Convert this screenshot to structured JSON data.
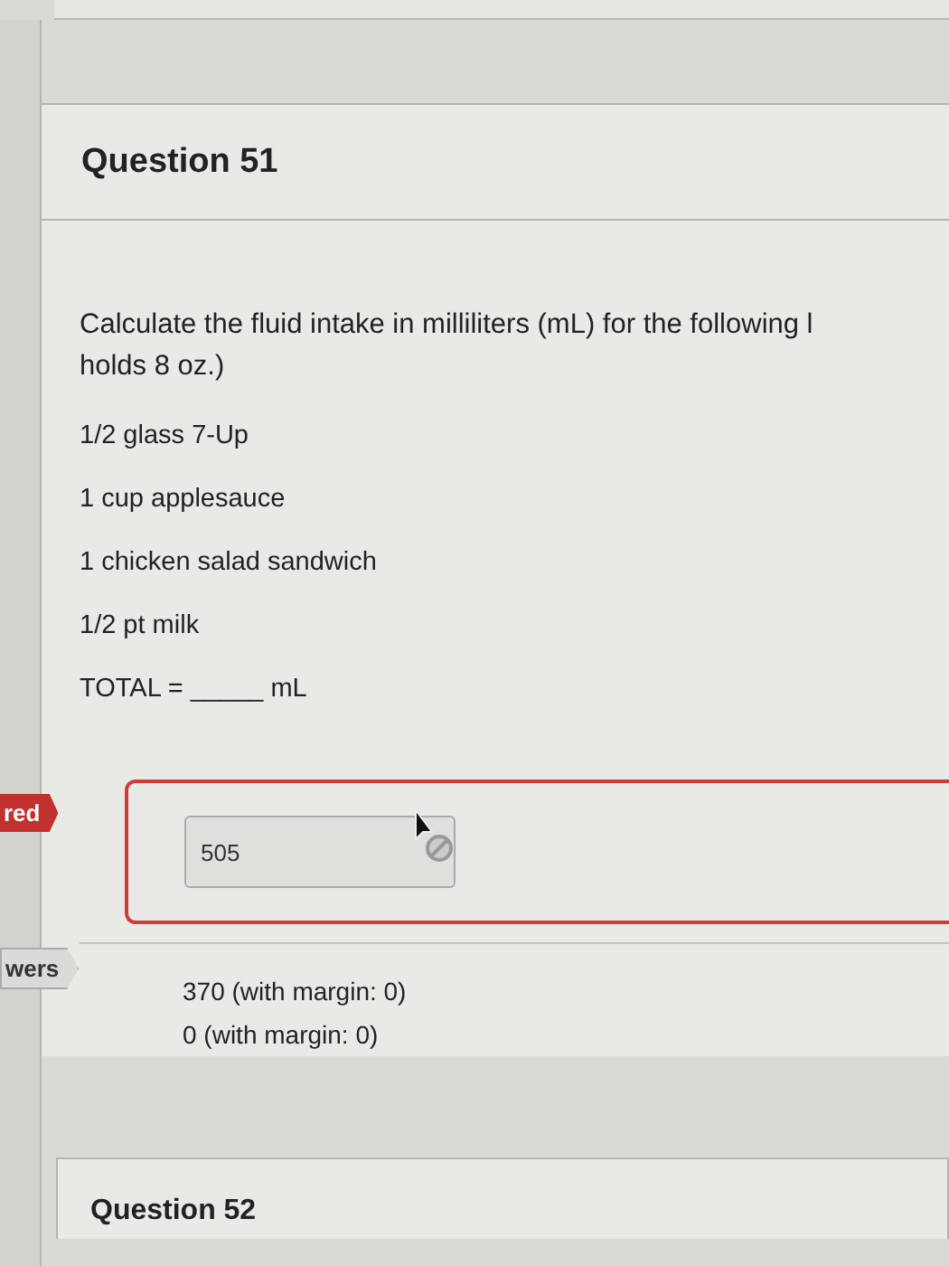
{
  "question": {
    "title": "Question 51",
    "prompt_lines": [
      "Calculate the fluid intake in milliliters (mL) for the following l",
      "holds 8 oz.)"
    ],
    "items": [
      "1/2 glass 7-Up",
      "1 cup applesauce",
      "1 chicken salad sandwich",
      "1/2 pt milk"
    ],
    "total": "TOTAL = _____ mL"
  },
  "response": {
    "tag": "red",
    "value": "505",
    "incorrect": true
  },
  "answers": {
    "tag": "wers",
    "values": [
      "370 (with margin: 0)",
      "0 (with margin: 0)"
    ]
  },
  "next_question": {
    "title": "Question 52"
  }
}
